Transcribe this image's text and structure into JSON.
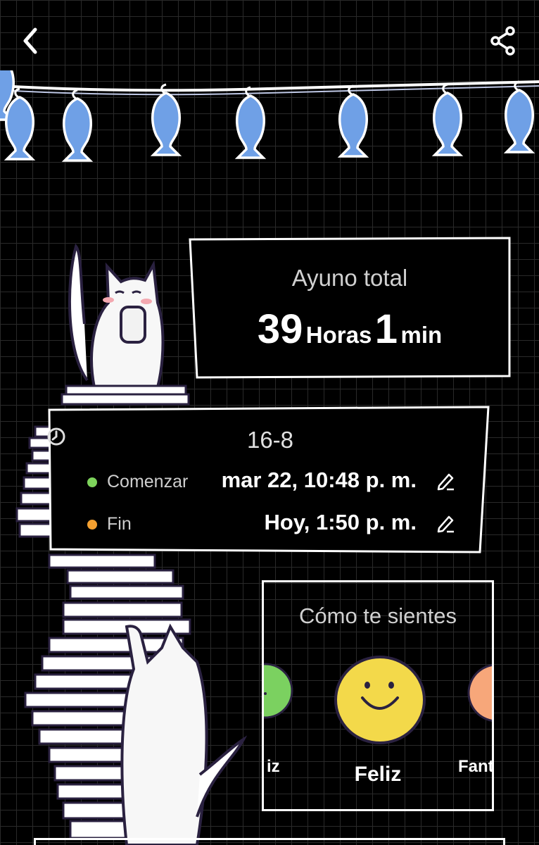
{
  "header": {
    "back_icon": "chevron-left-icon",
    "share_icon": "share-icon"
  },
  "total_fast": {
    "title": "Ayuno total",
    "hours": "39",
    "hours_unit": "Horas",
    "minutes": "1",
    "minutes_unit": "min"
  },
  "plan": {
    "icon": "clock-icon",
    "name": "16-8",
    "start": {
      "label": "Comenzar",
      "value": "mar 22, 10:48 p. m.",
      "dot_color": "#7dd35b"
    },
    "end": {
      "label": "Fin",
      "value": "Hoy, 1:50 p. m.",
      "dot_color": "#f4a030"
    }
  },
  "mood": {
    "title": "Cómo te sientes",
    "left_label": "iz",
    "center_label": "Feliz",
    "right_label": "Fant",
    "colors": {
      "left": "#7bd160",
      "center": "#f3d94a",
      "right": "#f7a77a"
    }
  }
}
